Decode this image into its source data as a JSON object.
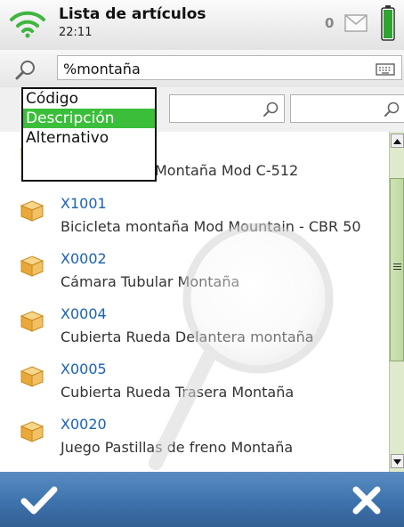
{
  "status_bar": {
    "title": "Lista de artículos",
    "time": "22:11",
    "message_count": "0",
    "icons": {
      "signal": "wifi-signal-icon",
      "mail": "mail-icon",
      "battery": "battery-icon"
    },
    "battery_color": "#2ea52e"
  },
  "search": {
    "value": "%montaña",
    "icon": "search-icon",
    "keyboard_icon": "keyboard-icon"
  },
  "filter_dropdown": {
    "options": [
      "Código",
      "Descripción",
      "Alternativo"
    ],
    "selected": "Descripción",
    "selected_color": "#3bbf3b"
  },
  "list": {
    "items": [
      {
        "code": "",
        "description": "Montaña Mod C-512"
      },
      {
        "code": "X1001",
        "description": "Bicicleta montaña Mod Mountain - CBR 50"
      },
      {
        "code": "X0002",
        "description": "Cámara Tubular Montaña"
      },
      {
        "code": "X0004",
        "description": "Cubierta Rueda Delantera montaña"
      },
      {
        "code": "X0005",
        "description": "Cubierta Rueda Trasera Montaña"
      },
      {
        "code": "X0020",
        "description": "Juego Pastillas de freno Montaña"
      }
    ],
    "code_color": "#1a62b5",
    "item_icon": "package-box-icon"
  },
  "bottom_bar": {
    "accept_icon": "checkmark-icon",
    "cancel_icon": "close-icon"
  }
}
